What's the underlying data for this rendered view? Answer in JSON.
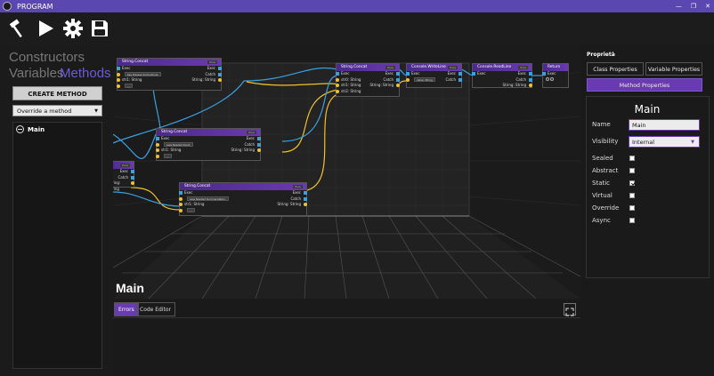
{
  "window": {
    "title": "PROGRAM",
    "controls": [
      "—",
      "❐",
      "✕"
    ]
  },
  "toolbar": {
    "icons": [
      "hammer-icon",
      "play-icon",
      "gear-icon",
      "save-icon"
    ]
  },
  "left": {
    "tabs": {
      "constructors": "Constructors",
      "variables": "Variables",
      "methods": "Methods"
    },
    "create_button": "CREATE METHOD",
    "override_select": "Override a method",
    "methods": [
      {
        "name": "Main"
      }
    ]
  },
  "canvas": {
    "title": "Main",
    "nodes": [
      {
        "title": "String.Concat",
        "tag": "Pure",
        "rows": [
          "Exec",
          "Key Pressed Instructions:",
          "str1: String",
          "…"
        ]
      },
      {
        "title": "String.Concat",
        "tag": "Pure",
        "rows": [
          "Exec",
          "Less Needed Input:",
          "str1: String",
          "…"
        ]
      },
      {
        "title": "String.Concat",
        "tag": "Pure",
        "rows": [
          "Exec",
          "Less Needed Summarization:",
          "str1: String",
          "…"
        ]
      },
      {
        "title": "",
        "tag": "Pure",
        "rows": [
          "Exec",
          "Catch",
          "String: String"
        ]
      },
      {
        "title": "String.Concat",
        "tag": "Pure",
        "rows": [
          "Exec",
          "str0: String",
          "str1: String",
          "str2: String"
        ]
      },
      {
        "title": "Console.WriteLine",
        "tag": "Pure",
        "rows": [
          "Exec",
          "value: String"
        ]
      },
      {
        "title": "Console.ReadLine",
        "tag": "Pure",
        "rows": [
          "Exec"
        ]
      },
      {
        "title": "Return",
        "tag": "",
        "rows": [
          "Exec"
        ]
      }
    ],
    "row_outputs": {
      "exec": "Exec",
      "catch": "Catch",
      "string_out": "String: String",
      "str0": "str0: String",
      "str1": "str1: String",
      "str2": "str2: String"
    }
  },
  "bottom": {
    "tabs": [
      "Errors",
      "Code Editor"
    ],
    "active_tab": "Errors"
  },
  "right": {
    "header": "Proprietà",
    "tabs": {
      "class": "Class Properties",
      "variable": "Variable Properties",
      "method": "Method Properties"
    },
    "method_title": "Main",
    "name_label": "Name",
    "name_value": "Main",
    "visibility_label": "Visibility",
    "visibility_value": "Internal",
    "checkboxes": [
      {
        "label": "Sealed",
        "checked": false
      },
      {
        "label": "Abstract",
        "checked": false
      },
      {
        "label": "Static",
        "checked": true
      },
      {
        "label": "Virtual",
        "checked": false
      },
      {
        "label": "Override",
        "checked": false
      },
      {
        "label": "Async",
        "checked": false
      }
    ]
  },
  "colors": {
    "accent": "#6a3ab0",
    "titlebar": "#5b47b0",
    "exec_pin": "#3aa0e0",
    "string_pin": "#f2c12e"
  }
}
